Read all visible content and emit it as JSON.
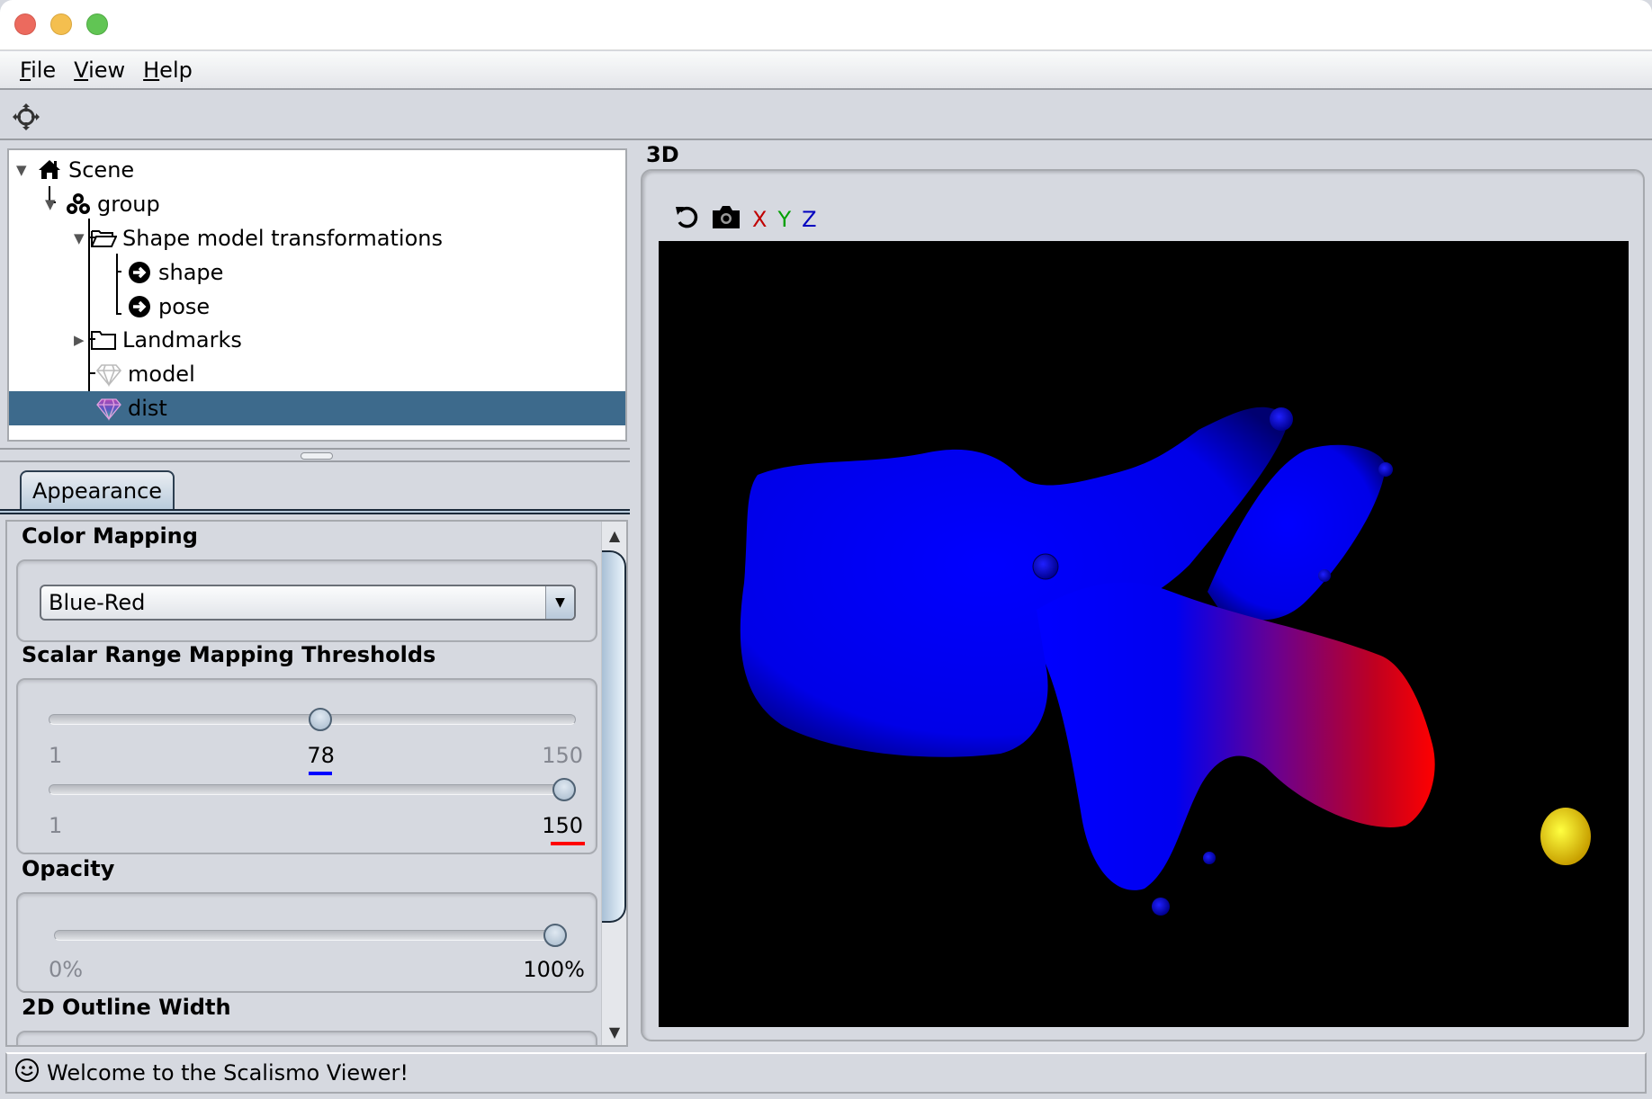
{
  "window": {
    "traffic_lights": [
      "close",
      "minimize",
      "maximize"
    ]
  },
  "menubar": {
    "items": [
      {
        "label_mnemonic": "F",
        "label_rest": "ile"
      },
      {
        "label_mnemonic": "V",
        "label_rest": "iew"
      },
      {
        "label_mnemonic": "H",
        "label_rest": "elp"
      }
    ]
  },
  "toolbar": {
    "icons": [
      "crosshair-icon"
    ]
  },
  "tree": {
    "nodes": [
      {
        "label": "Scene",
        "icon": "home-icon",
        "expanded": true,
        "depth": 0
      },
      {
        "label": "group",
        "icon": "group-icon",
        "expanded": true,
        "depth": 1
      },
      {
        "label": "Shape model transformations",
        "icon": "folder-open-icon",
        "expanded": true,
        "depth": 2
      },
      {
        "label": "shape",
        "icon": "arrow-circle-icon",
        "depth": 3
      },
      {
        "label": "pose",
        "icon": "arrow-circle-icon",
        "depth": 3
      },
      {
        "label": "Landmarks",
        "icon": "folder-icon",
        "expanded": false,
        "depth": 2
      },
      {
        "label": "model",
        "icon": "gem-icon",
        "depth": 2
      },
      {
        "label": "dist",
        "icon": "gem-color-icon",
        "depth": 2,
        "selected": true
      }
    ]
  },
  "properties": {
    "tabs": [
      {
        "label": "Appearance",
        "active": true
      }
    ],
    "color_mapping": {
      "title": "Color Mapping",
      "selected": "Blue-Red"
    },
    "scalar_range": {
      "title": "Scalar Range Mapping Thresholds",
      "lower": {
        "min": "1",
        "max": "150",
        "value": "78",
        "value_num": 78,
        "range": [
          1,
          150
        ],
        "underline_color": "#0000ff"
      },
      "upper": {
        "min": "1",
        "max": "150",
        "value": "150",
        "value_num": 150,
        "range": [
          1,
          150
        ],
        "underline_color": "#ff0000"
      }
    },
    "opacity": {
      "title": "Opacity",
      "min": "0%",
      "max": "100%",
      "value_percent": 100
    },
    "outline_width": {
      "title": "2D Outline Width"
    }
  },
  "viewer3d": {
    "title": "3D",
    "toolbar": {
      "reset_icon": "reset-view-icon",
      "snapshot_icon": "camera-icon",
      "axes": [
        {
          "label": "X",
          "color": "#c00000"
        },
        {
          "label": "Y",
          "color": "#00a000"
        },
        {
          "label": "Z",
          "color": "#0000c0"
        }
      ]
    },
    "scene": {
      "background": "#000000",
      "mesh_colors": {
        "low": "#0000ff",
        "high": "#ff0000"
      },
      "landmark_color": "#ffdd00"
    }
  },
  "status": {
    "icon": "smiley-icon",
    "message": "Welcome to the Scalismo Viewer!"
  }
}
